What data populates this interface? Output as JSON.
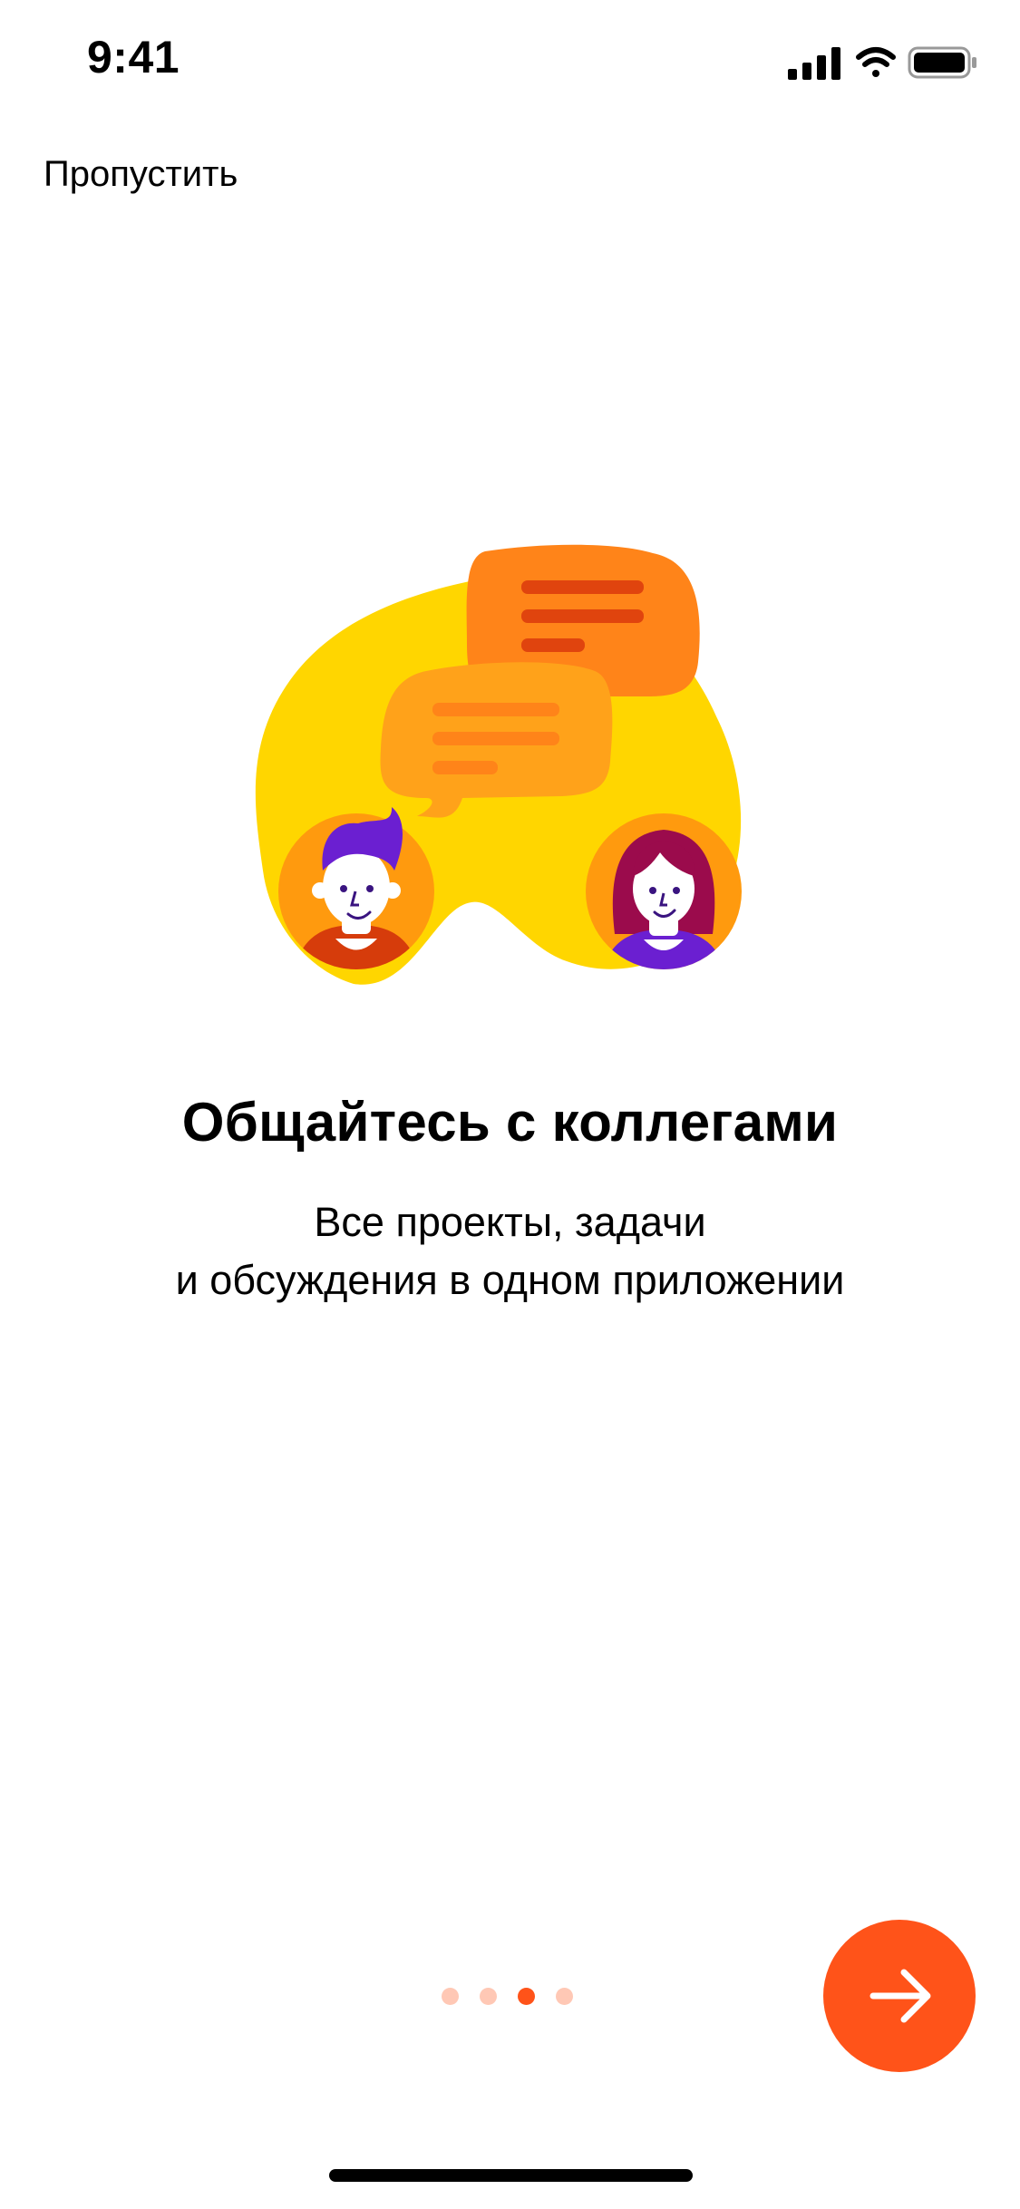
{
  "status_bar": {
    "time": "9:41",
    "icons": [
      "cellular-signal-icon",
      "wifi-icon",
      "battery-icon"
    ]
  },
  "header": {
    "skip_label": "Пропустить"
  },
  "illustration": {
    "icon": "colleagues-chat-icon",
    "colors": {
      "blob": "#FFD600",
      "bubble_back": "#FF8419",
      "bubble_front": "#FFA21A",
      "avatar_bg": "#FF9A0E"
    }
  },
  "content": {
    "title": "Общайтесь с коллегами",
    "subtitle_line1": "Все проекты, задачи",
    "subtitle_line2": "и обсуждения в одном приложении"
  },
  "pager": {
    "count": 4,
    "active_index": 2,
    "active_color": "#FF5319",
    "inactive_color": "#FFC8B5"
  },
  "next_button": {
    "icon": "arrow-right-icon",
    "color": "#FF5319"
  },
  "home_indicator": {
    "color": "#000000"
  }
}
